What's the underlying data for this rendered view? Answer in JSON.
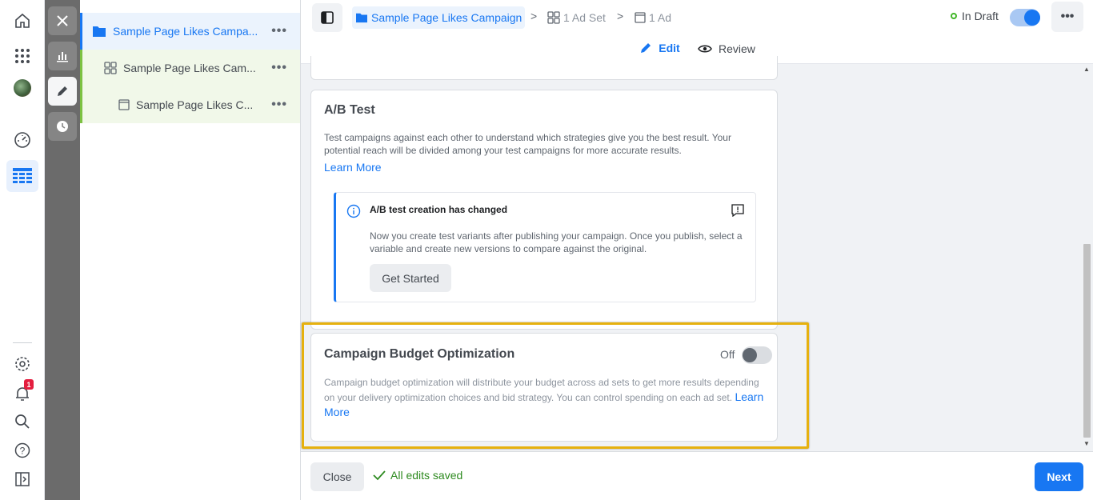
{
  "tree": {
    "campaign": "Sample Page Likes Campa...",
    "adset": "Sample Page Likes Cam...",
    "ad": "Sample Page Likes C...",
    "more": "•••"
  },
  "nav": {
    "notification_count": "1"
  },
  "breadcrumb": {
    "campaign": "Sample Page Likes Campaign",
    "adset": "1 Ad Set",
    "ad": "1 Ad",
    "separator": ">"
  },
  "status": {
    "label": "In Draft",
    "toggle_on": true
  },
  "header": {
    "more": "•••"
  },
  "tabs": {
    "edit": "Edit",
    "review": "Review"
  },
  "ab_test": {
    "title": "A/B Test",
    "description": "Test campaigns against each other to understand which strategies give you the best result. Your potential reach will be divided among your test campaigns for more accurate results.",
    "learn_more": "Learn More",
    "notice": {
      "title": "A/B test creation has changed",
      "text": "Now you create test variants after publishing your campaign. Once you publish, select a variable and create new versions to compare against the original.",
      "button": "Get Started"
    }
  },
  "cbo": {
    "title": "Campaign Budget Optimization",
    "toggle_label": "Off",
    "toggle_on": false,
    "description": "Campaign budget optimization will distribute your budget across ad sets to get more results depending on your delivery optimization choices and bid strategy. You can control spending on each ad set.",
    "learn_more": "Learn More"
  },
  "footer": {
    "close": "Close",
    "saved": "All edits saved",
    "next": "Next"
  },
  "colors": {
    "accent": "#1877f2",
    "highlight": "#e6b10e",
    "success": "#42b72a"
  }
}
